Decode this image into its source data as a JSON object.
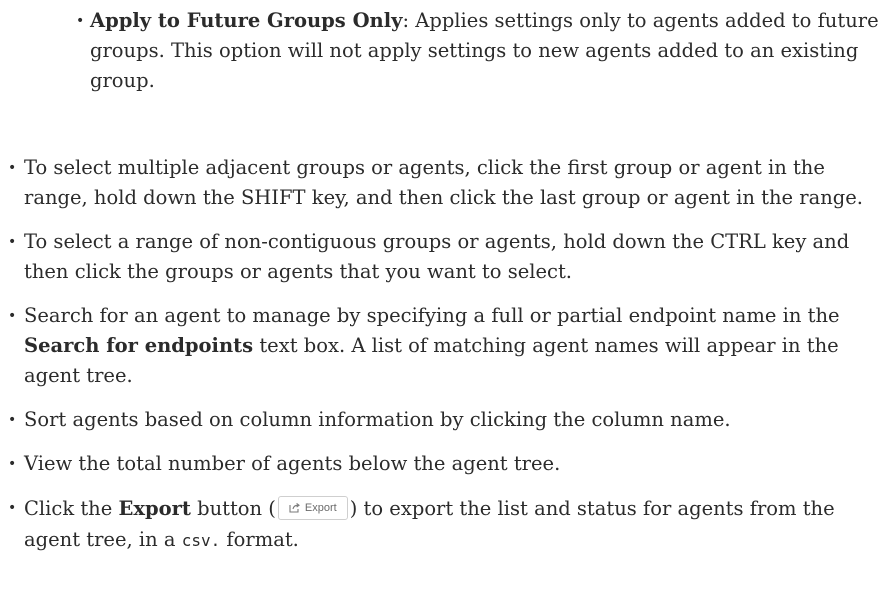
{
  "bullet_glyph": "•",
  "sub_item": {
    "term": "Apply to Future Groups Only",
    "text": ": Applies settings only to agents added to future groups. This option will not apply settings to new agents added to an existing group."
  },
  "items": [
    {
      "text": "To select multiple adjacent groups or agents, click the first group or agent in the range, hold down the SHIFT key, and then click the last group or agent in the range."
    },
    {
      "text": "To select a range of non-contiguous groups or agents, hold down the CTRL key and then click the groups or agents that you want to select."
    },
    {
      "before": "Search for an agent to manage by specifying a full or partial endpoint name in the ",
      "bold": "Search for endpoints",
      "after": " text box. A list of matching agent names will appear in the agent tree."
    },
    {
      "text": "Sort agents based on column information by clicking the column name."
    },
    {
      "text": "View the total number of agents below the agent tree."
    },
    {
      "before": "Click the ",
      "bold": "Export",
      "middle": " button (",
      "button_label": "Export",
      "after_button": ") to export the list and status for agents from the agent tree, in a ",
      "code": "csv.",
      "end": " format."
    }
  ],
  "icons": {
    "export_icon": "export-arrow-icon"
  }
}
